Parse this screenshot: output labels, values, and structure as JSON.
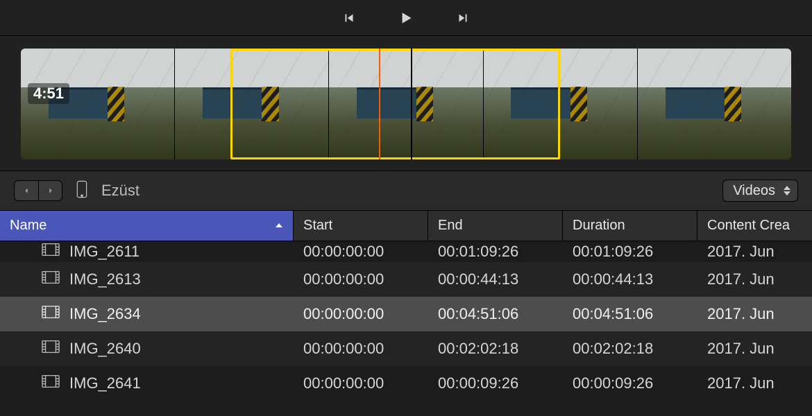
{
  "playback": {
    "prev_tooltip": "Previous",
    "play_tooltip": "Play",
    "next_tooltip": "Next"
  },
  "filmstrip": {
    "duration_label": "4:51",
    "selection_start_pct": 27.2,
    "selection_end_pct": 70.0,
    "playhead_pct": 46.5,
    "range_marker_pct": 50.6
  },
  "browser": {
    "device_name": "Ezüst",
    "filter_label": "Videos"
  },
  "table": {
    "columns": {
      "name": "Name",
      "start": "Start",
      "end": "End",
      "duration": "Duration",
      "content_created": "Content Crea"
    },
    "sort_column": "name",
    "rows": [
      {
        "name": "IMG_2611",
        "start": "00:00:00:00",
        "end": "00:01:09:26",
        "duration": "00:01:09:26",
        "content_created": "2017. Jun",
        "partial": true
      },
      {
        "name": "IMG_2613",
        "start": "00:00:00:00",
        "end": "00:00:44:13",
        "duration": "00:00:44:13",
        "content_created": "2017. Jun"
      },
      {
        "name": "IMG_2634",
        "start": "00:00:00:00",
        "end": "00:04:51:06",
        "duration": "00:04:51:06",
        "content_created": "2017. Jun",
        "selected": true
      },
      {
        "name": "IMG_2640",
        "start": "00:00:00:00",
        "end": "00:02:02:18",
        "duration": "00:02:02:18",
        "content_created": "2017. Jun"
      },
      {
        "name": "IMG_2641",
        "start": "00:00:00:00",
        "end": "00:00:09:26",
        "duration": "00:00:09:26",
        "content_created": "2017. Jun"
      }
    ]
  }
}
